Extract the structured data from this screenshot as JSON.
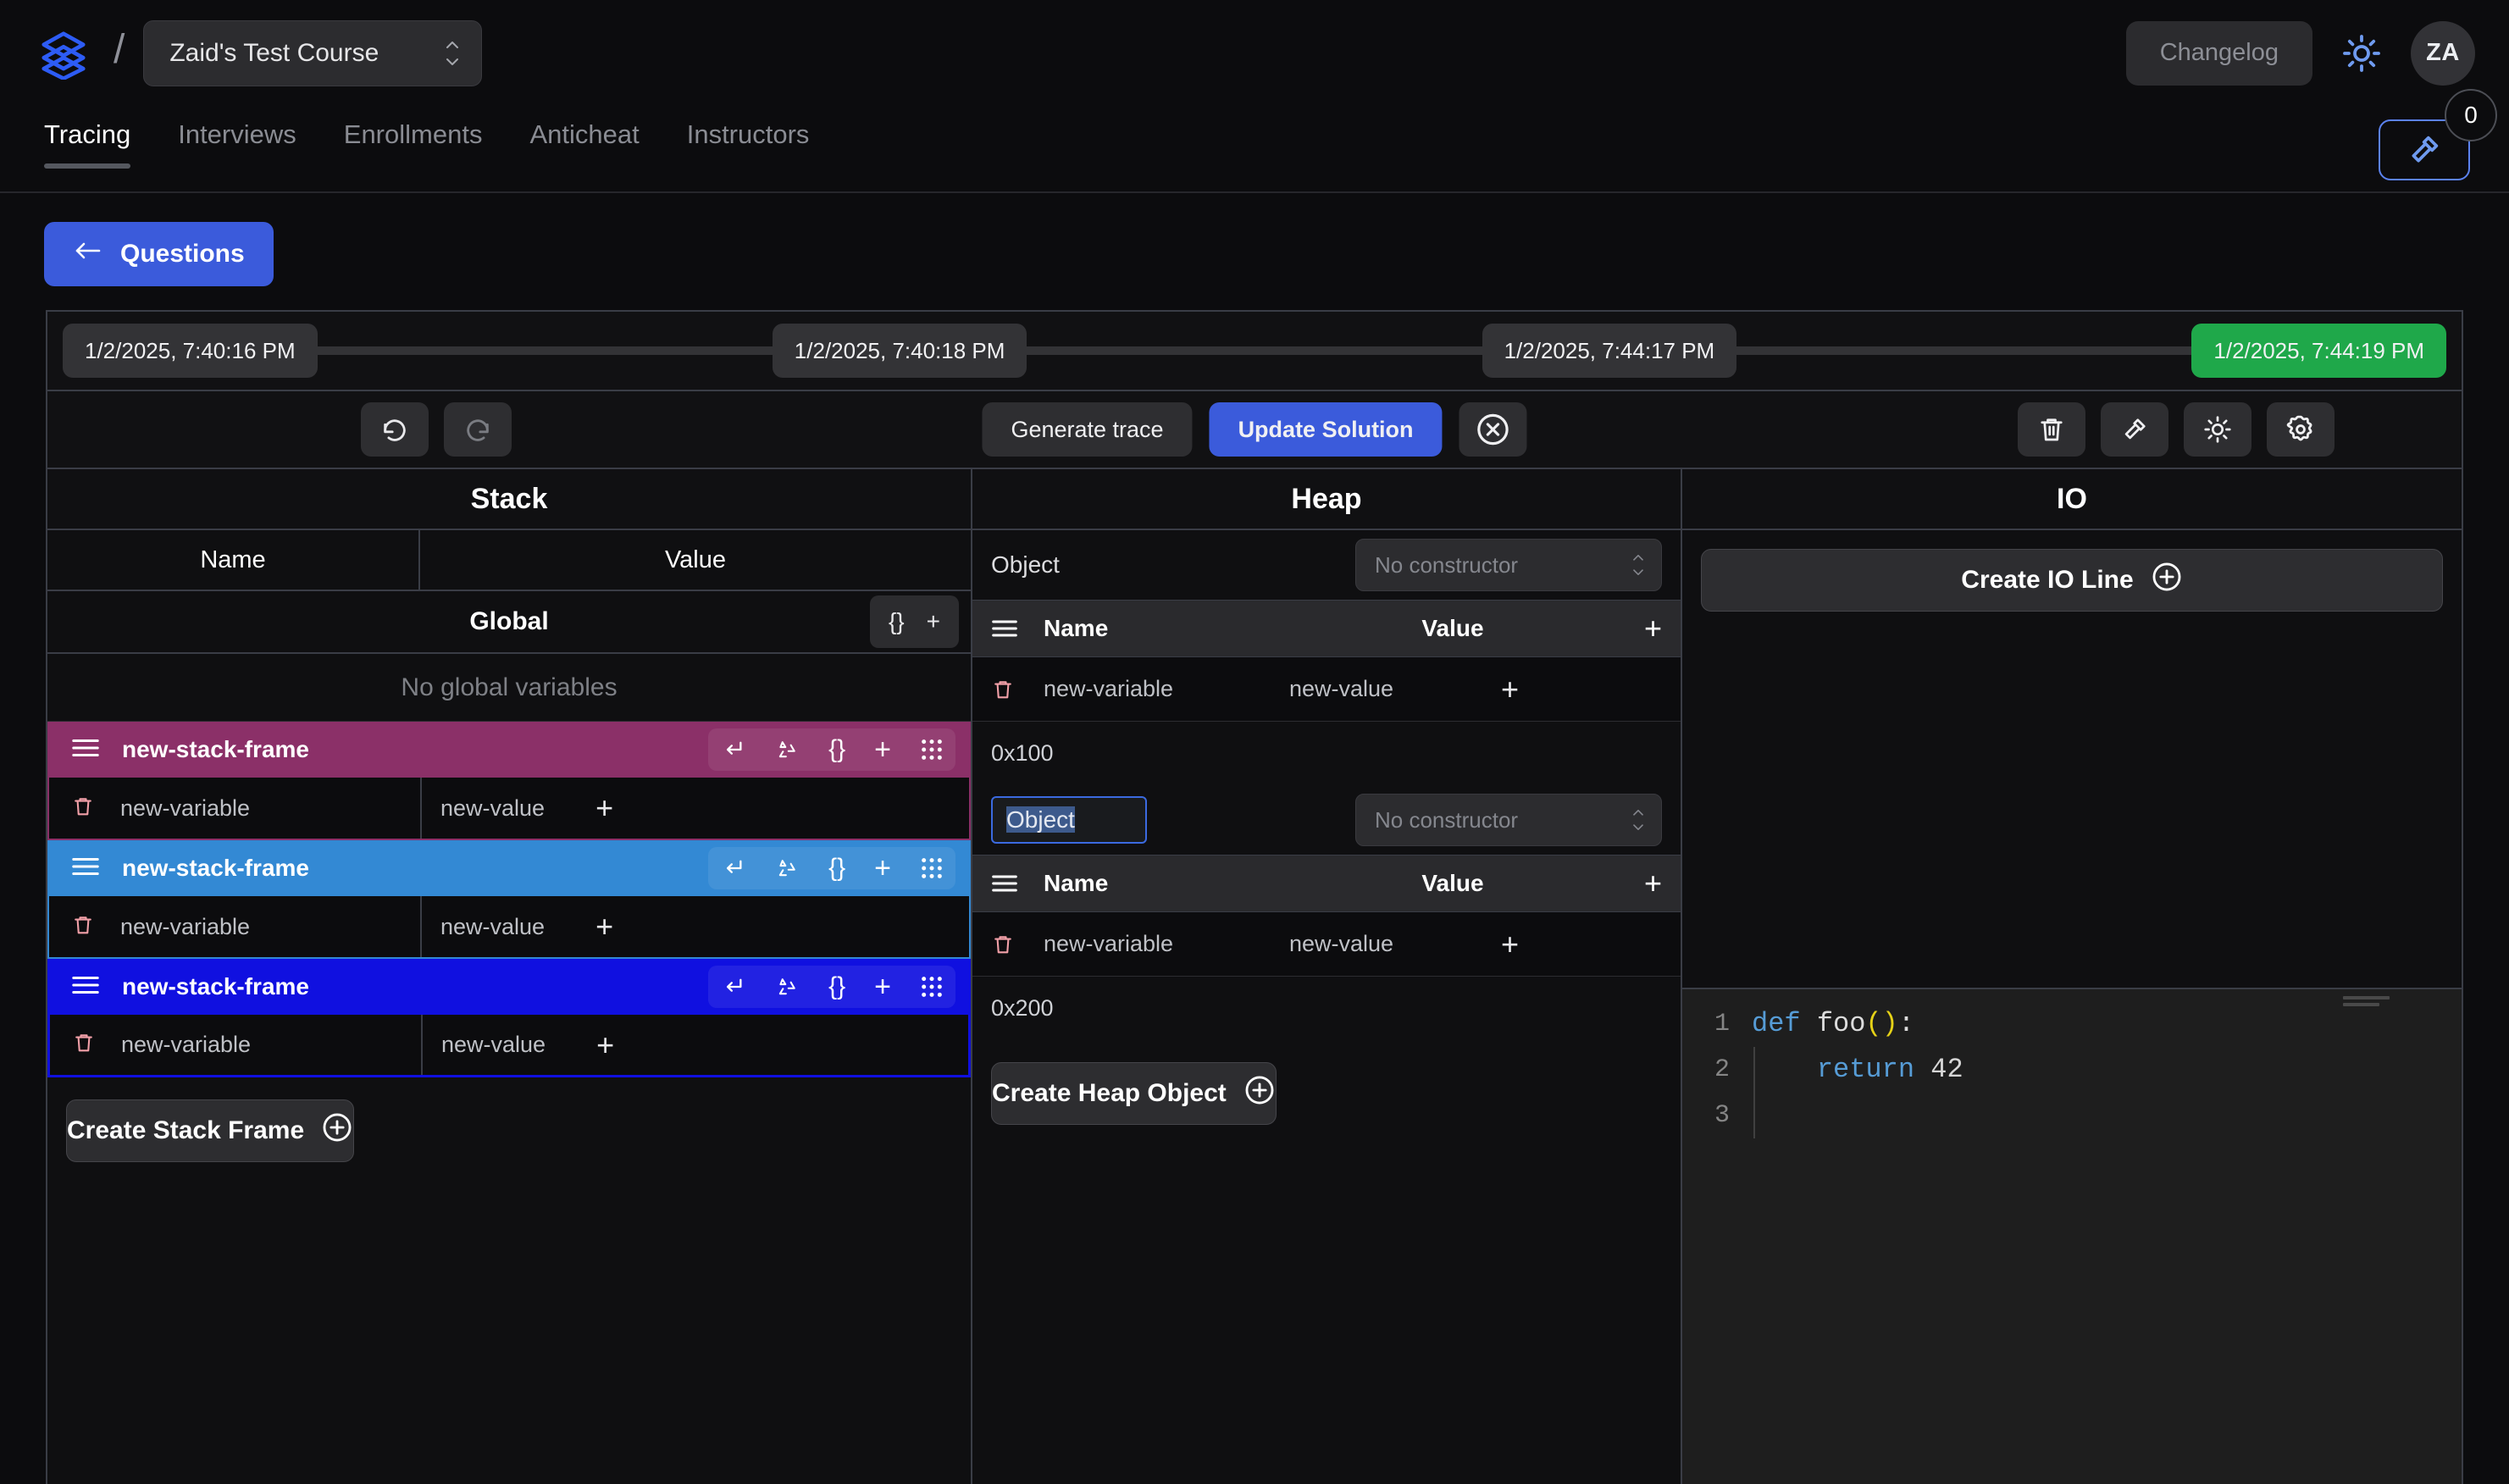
{
  "header": {
    "logo_icon": "layers-icon",
    "separator": "/",
    "course_name": "Zaid's Test Course",
    "changelog_label": "Changelog",
    "theme_icon": "sun-icon",
    "avatar_initials": "ZA"
  },
  "tabs": [
    {
      "label": "Tracing",
      "active": true
    },
    {
      "label": "Interviews",
      "active": false
    },
    {
      "label": "Enrollments",
      "active": false
    },
    {
      "label": "Anticheat",
      "active": false
    },
    {
      "label": "Instructors",
      "active": false
    }
  ],
  "gavel": {
    "icon": "gavel-icon",
    "badge_count": "0"
  },
  "back_button": {
    "label": "Questions",
    "icon": "arrow-left-icon"
  },
  "timeline": {
    "items": [
      {
        "label": "1/2/2025, 7:40:16 PM",
        "active": false
      },
      {
        "label": "1/2/2025, 7:40:18 PM",
        "active": false
      },
      {
        "label": "1/2/2025, 7:44:17 PM",
        "active": false
      },
      {
        "label": "1/2/2025, 7:44:19 PM",
        "active": true
      }
    ],
    "active_color": "#1fa84a"
  },
  "toolbar": {
    "undo_icon": "undo-icon",
    "redo_icon": "redo-icon",
    "generate_trace_label": "Generate trace",
    "update_solution_label": "Update Solution",
    "update_solution_color": "#3b5bdb",
    "cancel_icon": "circle-x-icon",
    "delete_icon": "trash-icon",
    "gavel_icon": "gavel-icon",
    "theme_icon": "sun-icon",
    "settings_icon": "gear-icon"
  },
  "stack": {
    "title": "Stack",
    "columns": {
      "name": "Name",
      "value": "Value"
    },
    "global": {
      "label": "Global",
      "braces_label": "{}",
      "plus_label": "+",
      "empty_text": "No global variables"
    },
    "frames": [
      {
        "name": "new-stack-frame",
        "color": "#8b3068",
        "menu_icon": "hamburger-icon",
        "actions": [
          "return-icon",
          "recycle-icon",
          "braces-icon",
          "plus-icon",
          "drag-grid-icon"
        ],
        "variables": [
          {
            "name": "new-variable",
            "value": "new-value",
            "delete_icon": "trash-icon",
            "plus_label": "+"
          }
        ]
      },
      {
        "name": "new-stack-frame",
        "color": "#3389d4",
        "menu_icon": "hamburger-icon",
        "actions": [
          "return-icon",
          "recycle-icon",
          "braces-icon",
          "plus-icon",
          "drag-grid-icon"
        ],
        "variables": [
          {
            "name": "new-variable",
            "value": "new-value",
            "delete_icon": "trash-icon",
            "plus_label": "+"
          }
        ]
      },
      {
        "name": "new-stack-frame",
        "color": "#1010e0",
        "menu_icon": "hamburger-icon",
        "actions": [
          "return-icon",
          "recycle-icon",
          "braces-icon",
          "plus-icon",
          "drag-grid-icon"
        ],
        "variables": [
          {
            "name": "new-variable",
            "value": "new-value",
            "delete_icon": "trash-icon",
            "plus_label": "+"
          }
        ]
      }
    ],
    "create_label": "Create Stack Frame"
  },
  "heap": {
    "title": "Heap",
    "objects": [
      {
        "name": "Object",
        "editing": false,
        "constructor_placeholder": "No constructor",
        "columns": {
          "name": "Name",
          "value": "Value"
        },
        "add_label": "+",
        "rows": [
          {
            "name": "new-variable",
            "value": "new-value",
            "plus_label": "+"
          }
        ],
        "address": "0x100"
      },
      {
        "name": "Object",
        "editing": true,
        "constructor_placeholder": "No constructor",
        "columns": {
          "name": "Name",
          "value": "Value"
        },
        "add_label": "+",
        "rows": [
          {
            "name": "new-variable",
            "value": "new-value",
            "plus_label": "+"
          }
        ],
        "address": "0x200"
      }
    ],
    "create_label": "Create Heap Object"
  },
  "io": {
    "title": "IO",
    "create_label": "Create IO Line"
  },
  "editor": {
    "language": "python",
    "line_numbers": [
      "1",
      "2",
      "3"
    ],
    "lines": [
      {
        "tokens": [
          {
            "t": "def ",
            "c": "kw"
          },
          {
            "t": "foo",
            "c": "fn"
          },
          {
            "t": "()",
            "c": "paren"
          },
          {
            "t": ":",
            "c": "punct"
          }
        ]
      },
      {
        "tokens": [
          {
            "t": "    ",
            "c": "punct"
          },
          {
            "t": "return ",
            "c": "kw"
          },
          {
            "t": "42",
            "c": "num"
          }
        ]
      },
      {
        "tokens": []
      }
    ],
    "plain_text": "def foo():\n    return 42\n"
  }
}
